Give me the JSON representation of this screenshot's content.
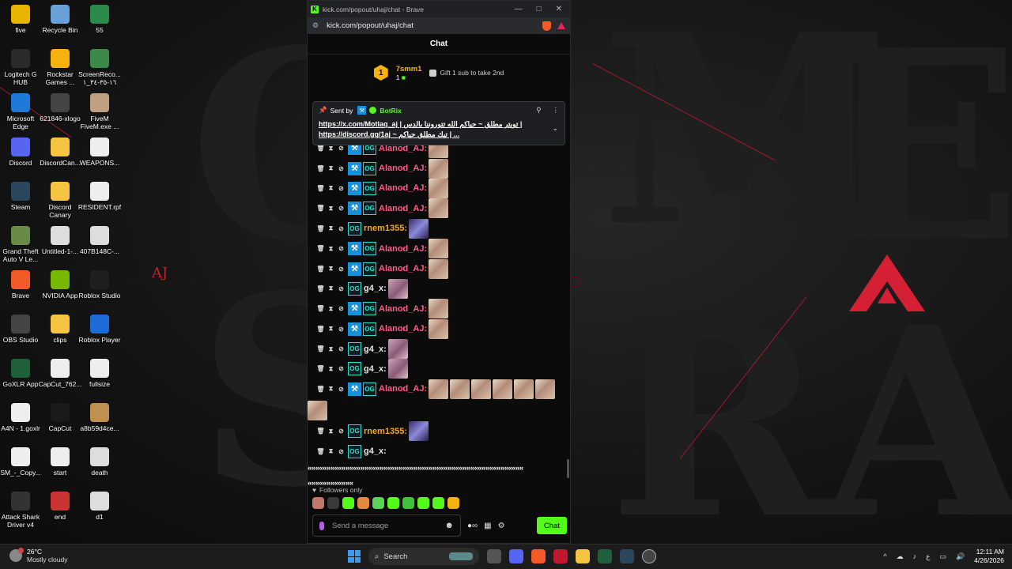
{
  "desktop": {
    "icons": [
      {
        "label": "five"
      },
      {
        "label": "Recycle Bin"
      },
      {
        "label": "55"
      },
      {
        "label": "Logitech G HUB"
      },
      {
        "label": "Rockstar Games ..."
      },
      {
        "label": "ScreenReco... ١٦-٣٥-٣٤_١"
      },
      {
        "label": "Microsoft Edge"
      },
      {
        "label": "621846-xlogo"
      },
      {
        "label": "FiveM FiveM.exe ..."
      },
      {
        "label": "Discord"
      },
      {
        "label": "DiscordCan..."
      },
      {
        "label": "WEAPONS..."
      },
      {
        "label": "Steam"
      },
      {
        "label": "Discord Canary"
      },
      {
        "label": "RESIDENT.rpf"
      },
      {
        "label": "Grand Theft Auto V Le..."
      },
      {
        "label": "Untitled-1-..."
      },
      {
        "label": "407B148C-..."
      },
      {
        "label": "Brave"
      },
      {
        "label": "NVIDIA App"
      },
      {
        "label": "Roblox Studio"
      },
      {
        "label": "OBS Studio"
      },
      {
        "label": "clips"
      },
      {
        "label": "Roblox Player"
      },
      {
        "label": "GoXLR App"
      },
      {
        "label": "CapCut_762..."
      },
      {
        "label": "fullsize"
      },
      {
        "label": "A4N - 1.goxlr"
      },
      {
        "label": "CapCut"
      },
      {
        "label": "a8b59d4ce..."
      },
      {
        "label": "SM_-_Copy..."
      },
      {
        "label": "start"
      },
      {
        "label": "death"
      },
      {
        "label": "Attack Shark Driver v4"
      },
      {
        "label": "end"
      },
      {
        "label": "d1"
      }
    ],
    "wallpaper_text": "AJ"
  },
  "browser": {
    "title": "kick.com/popout/uhaj/chat - Brave",
    "url": "kick.com/popout/uhaj/chat"
  },
  "chat": {
    "header": "Chat",
    "top_gifter": {
      "rank": "1",
      "name": "7smm1",
      "count": "1"
    },
    "gift_cta": "Gift 1 sub to take 2nd",
    "pinned": {
      "sent_by": "Sent by",
      "bot": "BotRix",
      "line1": "https://x.com/Motlaq_aj | تويتر مطلق ~ حياكم الله تتوروننا بالدس |",
      "line2": "https://discord.gg/1aj ~ تيك مطلق حياكم | ..."
    },
    "messages": [
      {
        "user": "Alanod_AJ:",
        "color": "#ff5c8a",
        "tool": true,
        "emotes": [
          "photo"
        ]
      },
      {
        "user": "Alanod_AJ:",
        "color": "#ff5c8a",
        "tool": true,
        "emotes": [
          "photo"
        ]
      },
      {
        "user": "Alanod_AJ:",
        "color": "#ff5c8a",
        "tool": true,
        "emotes": [
          "photo"
        ]
      },
      {
        "user": "Alanod_AJ:",
        "color": "#ff5c8a",
        "tool": true,
        "emotes": [
          "photo"
        ]
      },
      {
        "user": "rnem1355:",
        "color": "#f5a623",
        "tool": false,
        "emotes": [
          "purple"
        ]
      },
      {
        "user": "Alanod_AJ:",
        "color": "#ff5c8a",
        "tool": true,
        "emotes": [
          "photo"
        ]
      },
      {
        "user": "Alanod_AJ:",
        "color": "#ff5c8a",
        "tool": true,
        "emotes": [
          "photo"
        ]
      },
      {
        "user": "g4_x:",
        "color": "#e6e6e6",
        "tool": false,
        "emotes": [
          "pink"
        ]
      },
      {
        "user": "Alanod_AJ:",
        "color": "#ff5c8a",
        "tool": true,
        "emotes": [
          "photo"
        ]
      },
      {
        "user": "Alanod_AJ:",
        "color": "#ff5c8a",
        "tool": true,
        "emotes": [
          "photo"
        ]
      },
      {
        "user": "g4_x:",
        "color": "#e6e6e6",
        "tool": false,
        "emotes": [
          "pink"
        ]
      },
      {
        "user": "g4_x:",
        "color": "#e6e6e6",
        "tool": false,
        "emotes": [
          "pink"
        ]
      },
      {
        "user": "Alanod_AJ:",
        "color": "#ff5c8a",
        "tool": true,
        "emotes": [
          "photo",
          "photo",
          "photo",
          "photo",
          "photo",
          "photo"
        ]
      }
    ],
    "messages_after": [
      {
        "user": "rnem1355:",
        "color": "#f5a623",
        "tool": false,
        "emotes": [
          "purple"
        ]
      },
      {
        "user": "g4_x:",
        "color": "#e6e6e6",
        "tool": false,
        "emotes": []
      }
    ],
    "spam_line1": "«««««««««««««««««««««««««««««««««««««««««««««««««««««««««",
    "spam_line2": "««««««««««««",
    "followers_only": "Followers only",
    "input_placeholder": "Send a message",
    "send_label": "Chat"
  },
  "taskbar": {
    "temp": "26°C",
    "weather": "Mostly cloudy",
    "search": "Search",
    "time": "12:11 AM",
    "date": "4/26/2026",
    "lang": "ع"
  },
  "colors": {
    "kick_green": "#53fc18",
    "accent_red": "#c0182f"
  }
}
